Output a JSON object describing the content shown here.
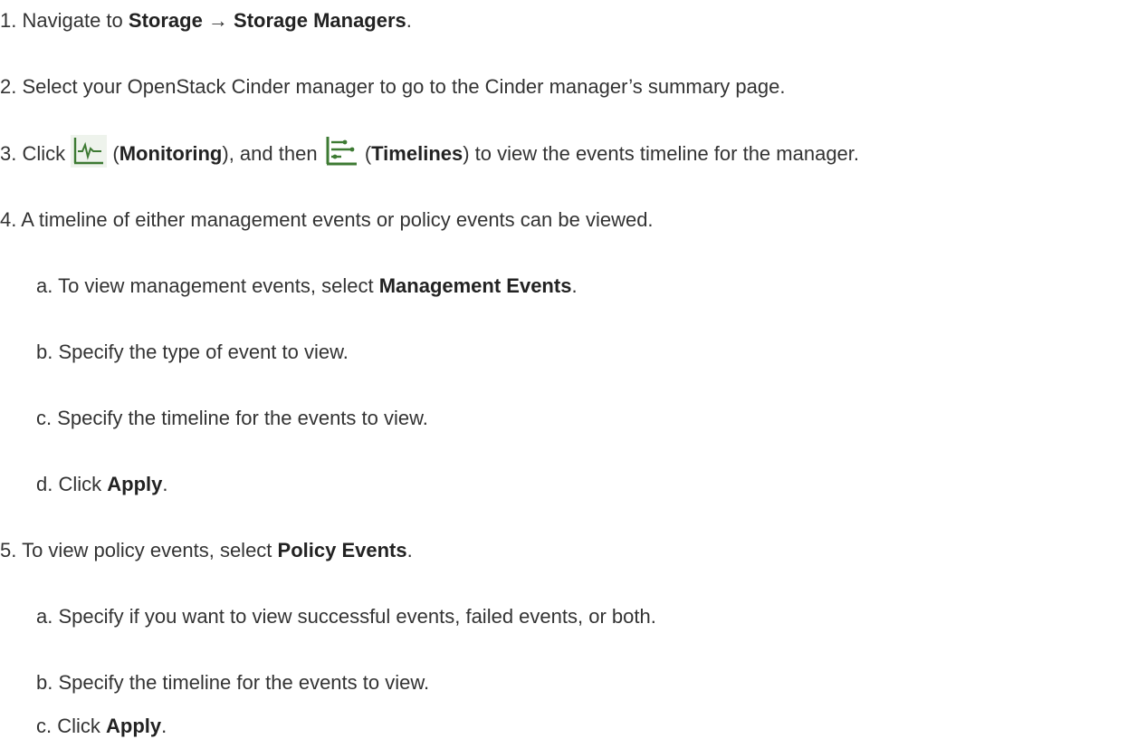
{
  "steps": [
    {
      "num": "1.",
      "parts": [
        "Navigate to ",
        "Storage",
        " → ",
        "Storage Managers",
        "."
      ]
    },
    {
      "num": "2.",
      "text": "Select your OpenStack Cinder manager to go to the Cinder manager’s summary page."
    },
    {
      "num": "3.",
      "click": "Click",
      "open1": "(",
      "monitoring": "Monitoring",
      "mid": "), and then",
      "open2": "(",
      "timelines": "Timelines",
      "tail": ") to view the events timeline for the manager."
    },
    {
      "num": "4.",
      "text": "A timeline of either management events or policy events can be viewed.",
      "sub": [
        {
          "letter": "a.",
          "pre": "To view management events, select ",
          "bold": "Management Events",
          "post": "."
        },
        {
          "letter": "b.",
          "text": "Specify the type of event to view."
        },
        {
          "letter": "c.",
          "text": "Specify the timeline for the events to view."
        },
        {
          "letter": "d.",
          "pre": "Click ",
          "bold": "Apply",
          "post": "."
        }
      ]
    },
    {
      "num": "5.",
      "pre": "To view policy events, select ",
      "bold": "Policy Events",
      "post": ".",
      "sub": [
        {
          "letter": "a.",
          "text": "Specify if you want to view successful events, failed events, or both."
        },
        {
          "letter": "b.",
          "text": "Specify the timeline for the events to view."
        },
        {
          "letter": "c.",
          "pre": "Click ",
          "bold": "Apply",
          "post": "."
        }
      ]
    }
  ],
  "icons": {
    "monitoring": "monitoring-chart-icon",
    "timelines": "timelines-icon",
    "accent": "#2e7d32"
  }
}
